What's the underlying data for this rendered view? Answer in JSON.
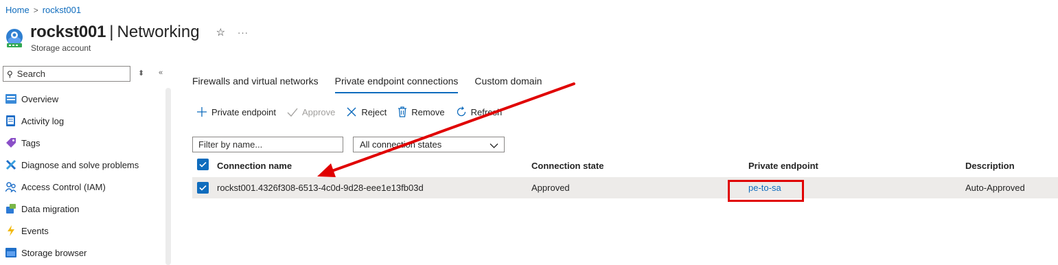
{
  "breadcrumb": {
    "home": "Home",
    "resource": "rockst001"
  },
  "header": {
    "resource_name": "rockst001",
    "separator": "|",
    "page_name": "Networking",
    "subtitle": "Storage account",
    "favorite_icon": "star-icon",
    "more_icon": "ellipsis-icon"
  },
  "sidebar": {
    "search_placeholder": "Search",
    "items": [
      {
        "label": "Overview",
        "icon": "overview-icon"
      },
      {
        "label": "Activity log",
        "icon": "activity-log-icon"
      },
      {
        "label": "Tags",
        "icon": "tag-icon"
      },
      {
        "label": "Diagnose and solve problems",
        "icon": "wrench-icon"
      },
      {
        "label": "Access Control (IAM)",
        "icon": "people-icon"
      },
      {
        "label": "Data migration",
        "icon": "migration-icon"
      },
      {
        "label": "Events",
        "icon": "lightning-icon"
      },
      {
        "label": "Storage browser",
        "icon": "storage-browser-icon"
      }
    ]
  },
  "tabs": [
    {
      "label": "Firewalls and virtual networks",
      "active": false
    },
    {
      "label": "Private endpoint connections",
      "active": true
    },
    {
      "label": "Custom domain",
      "active": false
    }
  ],
  "toolbar": {
    "add_label": "Private endpoint",
    "approve_label": "Approve",
    "reject_label": "Reject",
    "remove_label": "Remove",
    "refresh_label": "Refresh"
  },
  "filters": {
    "name_placeholder": "Filter by name...",
    "state_selected": "All connection states"
  },
  "table": {
    "columns": [
      "Connection name",
      "Connection state",
      "Private endpoint",
      "Description"
    ],
    "rows": [
      {
        "connection_name": "rockst001.4326f308-6513-4c0d-9d28-eee1e13fb03d",
        "connection_state": "Approved",
        "private_endpoint": "pe-to-sa",
        "description": "Auto-Approved",
        "selected": true
      }
    ]
  },
  "colors": {
    "accent": "#0f6cbd",
    "annotation": "#e00000",
    "row_selected": "#edebe9"
  }
}
